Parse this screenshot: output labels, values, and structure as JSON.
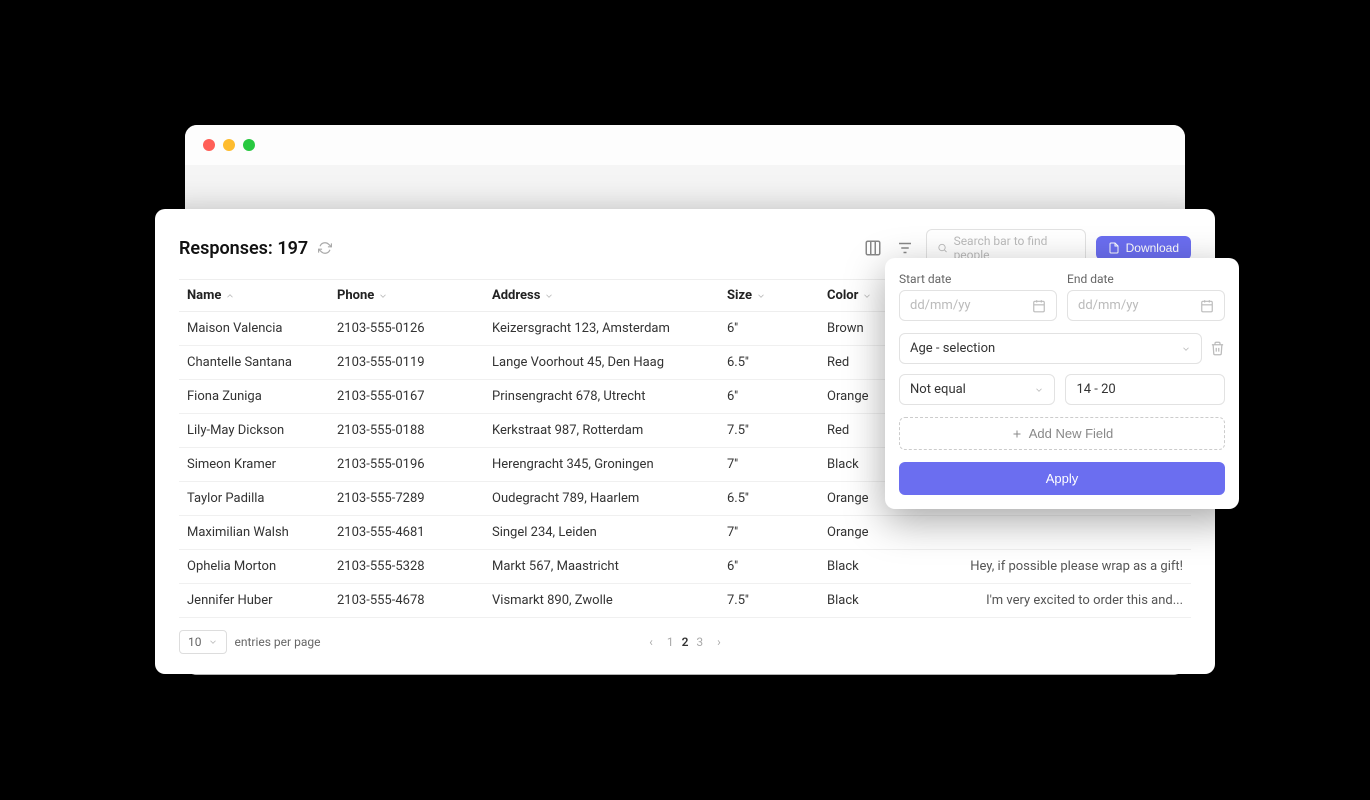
{
  "header": {
    "title_label": "Responses:",
    "count": "197",
    "search_placeholder": "Search bar to find people",
    "download_label": "Download"
  },
  "columns": {
    "name": "Name",
    "phone": "Phone",
    "address": "Address",
    "size": "Size",
    "color": "Color",
    "note": ""
  },
  "rows": [
    {
      "name": "Maison Valencia",
      "phone": "2103-555-0126",
      "address": "Keizersgracht 123, Amsterdam",
      "size": "6''",
      "color": "Brown",
      "note": ""
    },
    {
      "name": "Chantelle Santana",
      "phone": "2103-555-0119",
      "address": "Lange Voorhout 45, Den Haag",
      "size": "6.5''",
      "color": "Red",
      "note": ""
    },
    {
      "name": "Fiona Zuniga",
      "phone": "2103-555-0167",
      "address": "Prinsengracht 678, Utrecht",
      "size": "6''",
      "color": "Orange",
      "note": ""
    },
    {
      "name": "Lily-May Dickson",
      "phone": "2103-555-0188",
      "address": "Kerkstraat 987, Rotterdam",
      "size": "7.5''",
      "color": "Red",
      "note": ""
    },
    {
      "name": "Simeon Kramer",
      "phone": "2103-555-0196",
      "address": "Herengracht 345, Groningen",
      "size": "7''",
      "color": "Black",
      "note": ""
    },
    {
      "name": "Taylor Padilla",
      "phone": "2103-555-7289",
      "address": "Oudegracht 789, Haarlem",
      "size": "6.5''",
      "color": "Orange",
      "note": ""
    },
    {
      "name": "Maximilian Walsh",
      "phone": "2103-555-4681",
      "address": "Singel 234, Leiden",
      "size": "7''",
      "color": "Orange",
      "note": ""
    },
    {
      "name": "Ophelia Morton",
      "phone": "2103-555-5328",
      "address": "Markt 567, Maastricht",
      "size": "6''",
      "color": "Black",
      "note": "Hey, if possible please wrap as a gift!"
    },
    {
      "name": "Jennifer Huber",
      "phone": "2103-555-4678",
      "address": "Vismarkt 890, Zwolle",
      "size": "7.5''",
      "color": "Black",
      "note": "I'm very excited to order this and..."
    }
  ],
  "pagination": {
    "per_page_value": "10",
    "per_page_label": "entries per page",
    "pages": [
      "1",
      "2",
      "3"
    ],
    "current": "2"
  },
  "filter": {
    "start_label": "Start date",
    "end_label": "End date",
    "date_placeholder": "dd/mm/yy",
    "field_select": "Age - selection",
    "operator": "Not equal",
    "range_value": "14 - 20",
    "add_field_label": "Add New Field",
    "apply_label": "Apply"
  }
}
